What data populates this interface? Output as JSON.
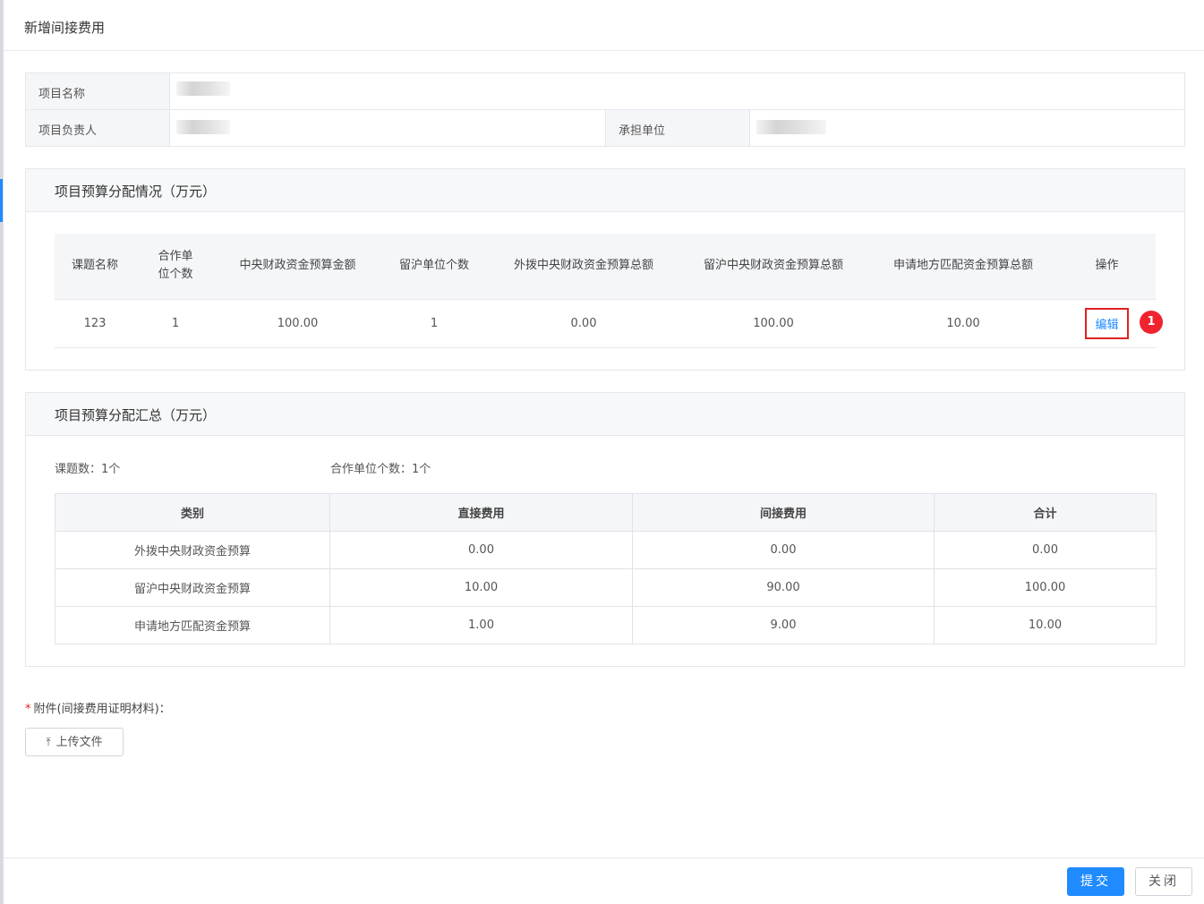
{
  "dialog": {
    "title": "新增间接费用"
  },
  "info": {
    "project_name_label": "项目名称",
    "project_leader_label": "项目负责人",
    "unit_label": "承担单位"
  },
  "allocation": {
    "title": "项目预算分配情况（万元）",
    "columns": [
      "课题名称",
      "合作单位个数",
      "中央财政资金预算金额",
      "留沪单位个数",
      "外拨中央财政资金预算总额",
      "留沪中央财政资金预算总额",
      "申请地方匹配资金预算总额",
      "操作"
    ],
    "row": {
      "name": "123",
      "partner_count": "1",
      "central_budget": "100.00",
      "local_unit_count": "1",
      "outbound_total": "0.00",
      "retained_total": "100.00",
      "local_match_total": "10.00",
      "action": "编辑"
    },
    "badge": "1"
  },
  "summary": {
    "title": "项目预算分配汇总（万元）",
    "topic_count": "课题数：1个",
    "partner_count": "合作单位个数：1个",
    "columns": [
      "类别",
      "直接费用",
      "间接费用",
      "合计"
    ],
    "rows": [
      [
        "外拨中央财政资金预算",
        "0.00",
        "0.00",
        "0.00"
      ],
      [
        "留沪中央财政资金预算",
        "10.00",
        "90.00",
        "100.00"
      ],
      [
        "申请地方匹配资金预算",
        "1.00",
        "9.00",
        "10.00"
      ]
    ]
  },
  "attachment": {
    "required_mark": "*",
    "label": "附件(间接费用证明材料)：",
    "upload_button": "上传文件"
  },
  "footer": {
    "submit": "提交",
    "close": "关闭"
  },
  "colors": {
    "primary": "#1f8bff",
    "highlight_red": "#e02020",
    "badge_red": "#f0242f"
  }
}
